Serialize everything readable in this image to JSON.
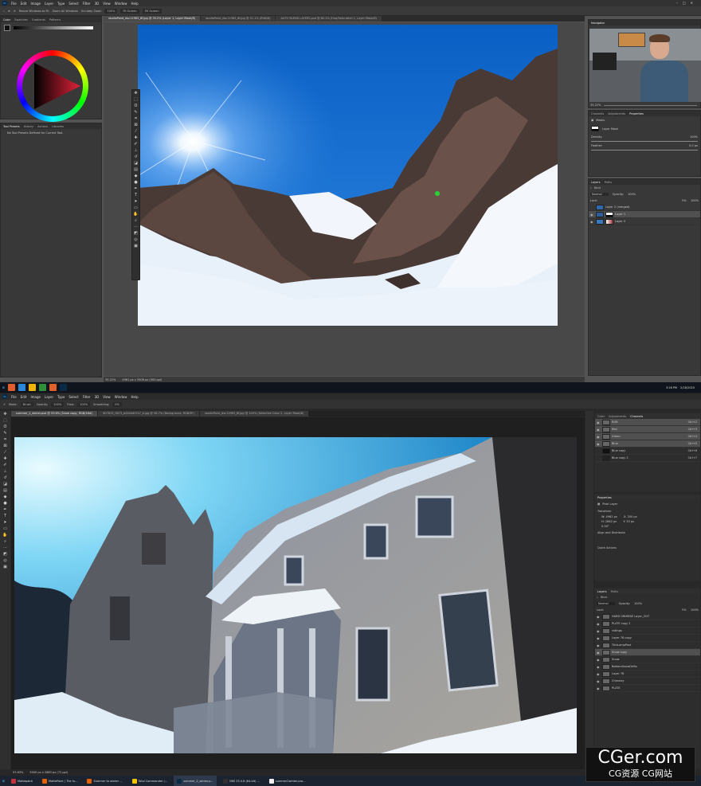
{
  "top": {
    "menu": [
      "File",
      "Edit",
      "Image",
      "Layer",
      "Type",
      "Select",
      "Filter",
      "3D",
      "View",
      "Window",
      "Help"
    ],
    "options": [
      "Resize Windows to Fit",
      "Zoom All Windows",
      "Scrubby Zoom",
      "100%",
      "Fit Screen",
      "Fill Screen"
    ],
    "tabs": [
      "studioPaint_dsc11963_8f.jpg @ 35.2% (Layer 1, Layer Mask/8)",
      "studioPaint_dsc11963_8f.jpg @ 51.1% (RGB/8)",
      "AUTO BLEND LAYERS.psd @ 80.1% (Hue/Saturation 1, Layer Mask/8)"
    ],
    "color_tabs": [
      "Color",
      "Swatches",
      "Gradients",
      "Patterns"
    ],
    "tool_presets_tabs": [
      "Tool Presets",
      "History",
      "Actions",
      "Libraries"
    ],
    "tool_presets_text": "No Tool Presets Defined for Current Tool.",
    "navigator_label": "Navigator",
    "navigator_zoom": "35.22%",
    "props_tabs": [
      "Channels",
      "Adjustments",
      "Properties"
    ],
    "masks_label": "Masks",
    "layer_mask_label": "Layer Mask",
    "density_label": "Density:",
    "density_value": "100%",
    "feather_label": "Feather:",
    "feather_value": "0.0 px",
    "layers_tabs": [
      "Layers",
      "Paths"
    ],
    "kind_label": "Kind",
    "blend_mode": "Normal",
    "opacity_label": "Opacity:",
    "opacity_value": "100%",
    "lock_label": "Lock:",
    "fill_label": "Fill:",
    "fill_value": "100%",
    "layers": [
      {
        "name": "Layer 2 (merged)",
        "selected": false
      },
      {
        "name": "Layer 1",
        "selected": true
      },
      {
        "name": "Layer 0",
        "selected": false
      }
    ],
    "status_zoom": "35.22%",
    "status_doc": "4961 px x 3508 px (300 ppi)",
    "taskbar_time": "3:28 PM",
    "taskbar_date": "2/18/2020"
  },
  "bottom": {
    "menu": [
      "File",
      "Edit",
      "Image",
      "Layer",
      "Type",
      "Select",
      "Filter",
      "3D",
      "View",
      "Window",
      "Help"
    ],
    "options": [
      "Mode:",
      "Brush",
      "Opacity:",
      "100%",
      "Flow:",
      "100%",
      "Smoothing:",
      "0%"
    ],
    "tabs": [
      "summer_2_winter.psd @ 53.6% (Snow copy, RGB/16#)",
      "607815_0873_b54b4d07s7_b.jpg @ 56.7% (Background, RGB/8*)",
      "studioPaint_dsc11963_8f.jpg @ 100% (Selective Color 2, Layer Mask/8)"
    ],
    "channels_tabs": [
      "Color",
      "Adjustments",
      "Channels"
    ],
    "channels": [
      {
        "name": "RGB",
        "key": "Ctrl+2"
      },
      {
        "name": "Red",
        "key": "Ctrl+3"
      },
      {
        "name": "Green",
        "key": "Ctrl+4"
      },
      {
        "name": "Blue",
        "key": "Ctrl+5"
      },
      {
        "name": "Blue copy",
        "key": "Ctrl+6"
      },
      {
        "name": "Blue copy 2",
        "key": "Ctrl+7"
      }
    ],
    "properties_label": "Properties",
    "pixel_layer_label": "Pixel Layer",
    "transform_label": "Transform",
    "w_value": "W: 4962 px",
    "h_value": "H: 2862 px",
    "x_value": "X: 200 px",
    "y_value": "Y: 33 px",
    "angle_value": "0.00°",
    "align_label": "Align and Distribute",
    "quick_actions_label": "Quick Actions",
    "layers_tabs": [
      "Layers",
      "Paths"
    ],
    "kind_label": "Kind",
    "blend_mode": "Normal",
    "opacity_label": "Opacity:",
    "opacity_value": "100%",
    "lock_label": "Lock:",
    "fill_label": "Fill:",
    "fill_value": "100%",
    "layers": [
      {
        "name": "HARD GRIMESE Layer_OUT",
        "selected": false
      },
      {
        "name": "PLATE copy 2",
        "selected": false
      },
      {
        "name": "railings",
        "selected": false
      },
      {
        "name": "Layer 78 copy",
        "selected": false
      },
      {
        "name": "ThisLampPost",
        "selected": false
      },
      {
        "name": "Snow copy",
        "selected": true
      },
      {
        "name": "Snow",
        "selected": false
      },
      {
        "name": "BottomSnowDrifts",
        "selected": false
      },
      {
        "name": "Layer 78",
        "selected": false
      },
      {
        "name": "Chimney",
        "selected": false
      },
      {
        "name": "PLATE",
        "selected": false
      }
    ],
    "status_zoom": "53.63%",
    "status_doc": "5000 px x 2883 px (72 ppi)",
    "taskbar_apps": [
      "Mattepaint",
      "MattePaint | The fu...",
      "Summer to winter ...",
      "Total Commander (...",
      "summer_2_winter.p...",
      "OBS 25.0.8 (64-bit) ...",
      "summer2winter.pro..."
    ]
  },
  "watermark": {
    "main": "CGer.com",
    "sub": "CG资源  CG网站"
  }
}
